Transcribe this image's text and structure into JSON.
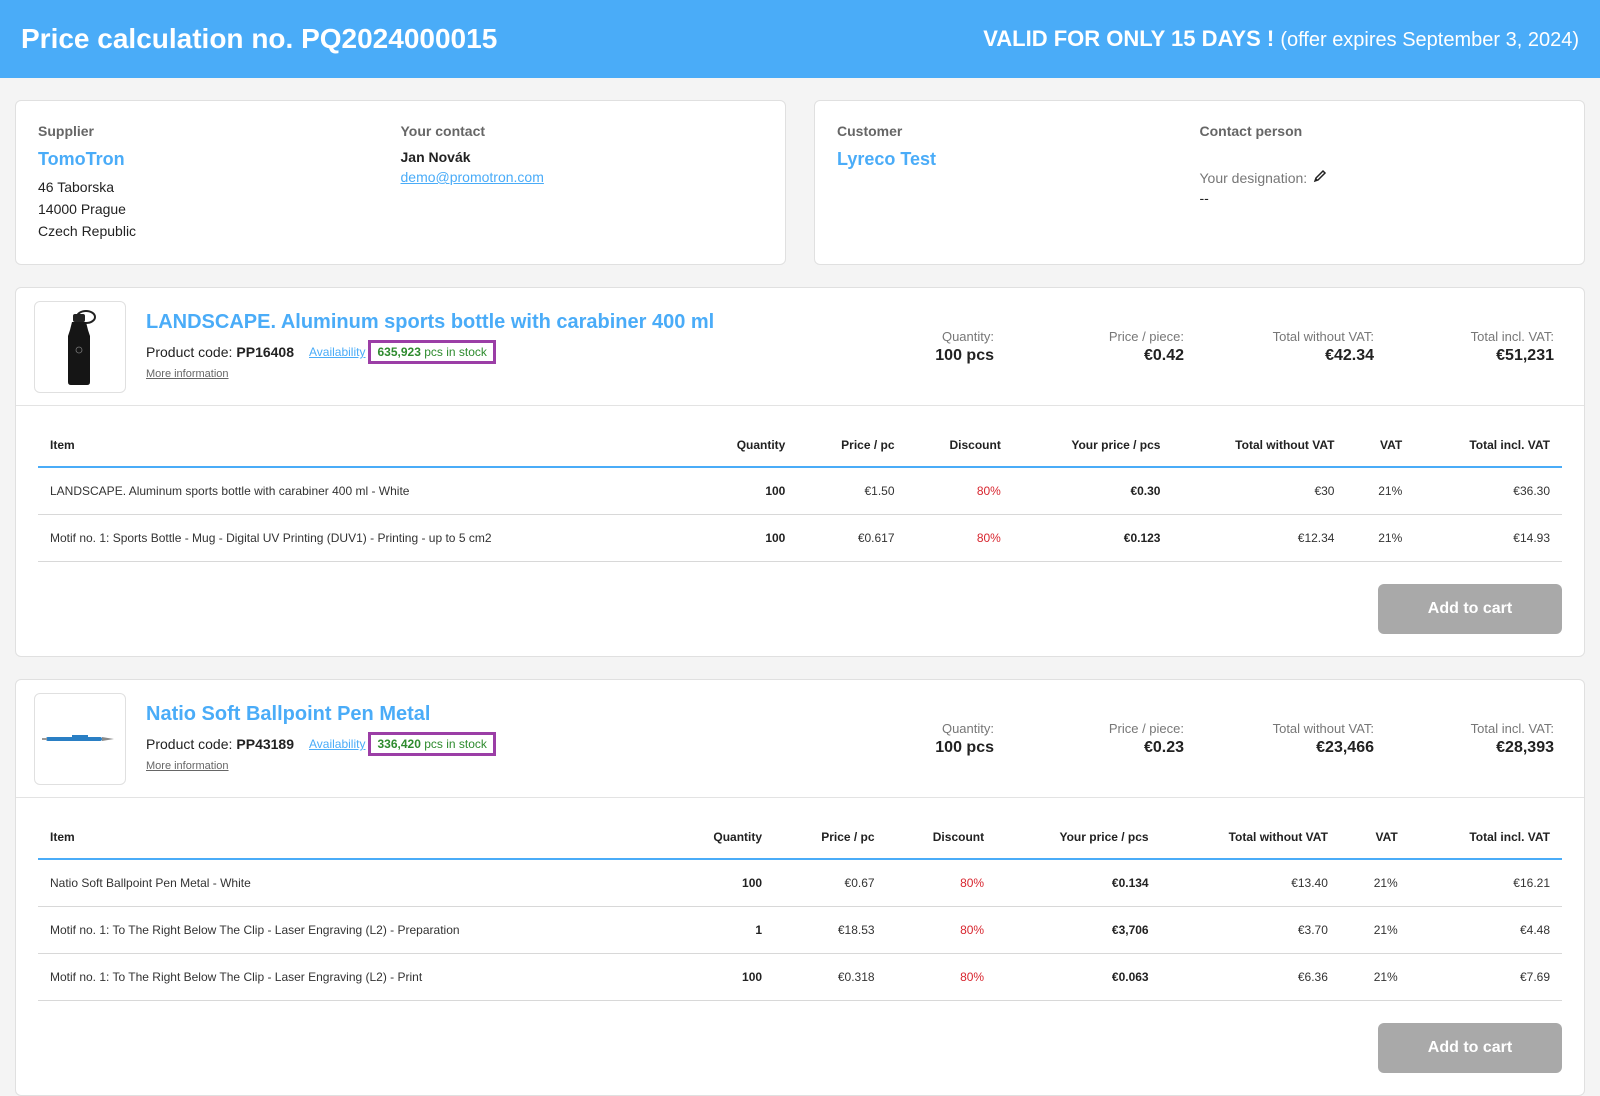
{
  "header": {
    "title": "Price calculation no. PQ2024000015",
    "validity": "VALID FOR ONLY 15 DAYS !",
    "expiry": "(offer expires September 3, 2024)"
  },
  "supplier": {
    "label": "Supplier",
    "name": "TomoTron",
    "address": [
      "46 Taborska",
      "14000 Prague",
      "Czech Republic"
    ]
  },
  "contact": {
    "label": "Your contact",
    "name": "Jan Novák",
    "email": "demo@promotron.com"
  },
  "customer": {
    "label": "Customer",
    "name": "Lyreco Test"
  },
  "contact_person": {
    "label": "Contact person",
    "designation_label": "Your designation:",
    "designation_value": "--"
  },
  "labels": {
    "product_code": "Product code:",
    "availability": "Availability",
    "more_info": "More information",
    "quantity": "Quantity:",
    "price_piece": "Price / piece:",
    "total_without_vat": "Total without VAT:",
    "total_incl_vat": "Total incl. VAT:",
    "add_to_cart": "Add to cart",
    "columns": [
      "Item",
      "Quantity",
      "Price / pc",
      "Discount",
      "Your price / pcs",
      "Total without VAT",
      "VAT",
      "Total incl. VAT"
    ]
  },
  "products": [
    {
      "title": "LANDSCAPE. Aluminum sports bottle with carabiner 400 ml",
      "code": "PP16408",
      "stock_qty": "635,923",
      "stock_text": "pcs in stock",
      "quantity": "100 pcs",
      "price_piece": "€0.42",
      "total_without_vat": "€42.34",
      "total_incl_vat": "€51,231",
      "rows": [
        {
          "item": "LANDSCAPE. Aluminum sports bottle with carabiner 400 ml - White",
          "qty": "100",
          "price": "€1.50",
          "discount": "80%",
          "your_price": "€0.30",
          "total_wo": "€30",
          "vat": "21%",
          "total_incl": "€36.30"
        },
        {
          "item": "Motif no. 1: Sports Bottle - Mug - Digital UV Printing (DUV1) - Printing - up to 5 cm2",
          "qty": "100",
          "price": "€0.617",
          "discount": "80%",
          "your_price": "€0.123",
          "total_wo": "€12.34",
          "vat": "21%",
          "total_incl": "€14.93"
        }
      ]
    },
    {
      "title": "Natio Soft Ballpoint Pen Metal",
      "code": "PP43189",
      "stock_qty": "336,420",
      "stock_text": "pcs in stock",
      "quantity": "100 pcs",
      "price_piece": "€0.23",
      "total_without_vat": "€23,466",
      "total_incl_vat": "€28,393",
      "rows": [
        {
          "item": "Natio Soft Ballpoint Pen Metal - White",
          "qty": "100",
          "price": "€0.67",
          "discount": "80%",
          "your_price": "€0.134",
          "total_wo": "€13.40",
          "vat": "21%",
          "total_incl": "€16.21"
        },
        {
          "item": "Motif no. 1: To The Right Below The Clip - Laser Engraving (L2) - Preparation",
          "qty": "1",
          "price": "€18.53",
          "discount": "80%",
          "your_price": "€3,706",
          "total_wo": "€3.70",
          "vat": "21%",
          "total_incl": "€4.48"
        },
        {
          "item": "Motif no. 1: To The Right Below The Clip - Laser Engraving (L2) - Print",
          "qty": "100",
          "price": "€0.318",
          "discount": "80%",
          "your_price": "€0.063",
          "total_wo": "€6.36",
          "vat": "21%",
          "total_incl": "€7.69"
        }
      ]
    }
  ]
}
